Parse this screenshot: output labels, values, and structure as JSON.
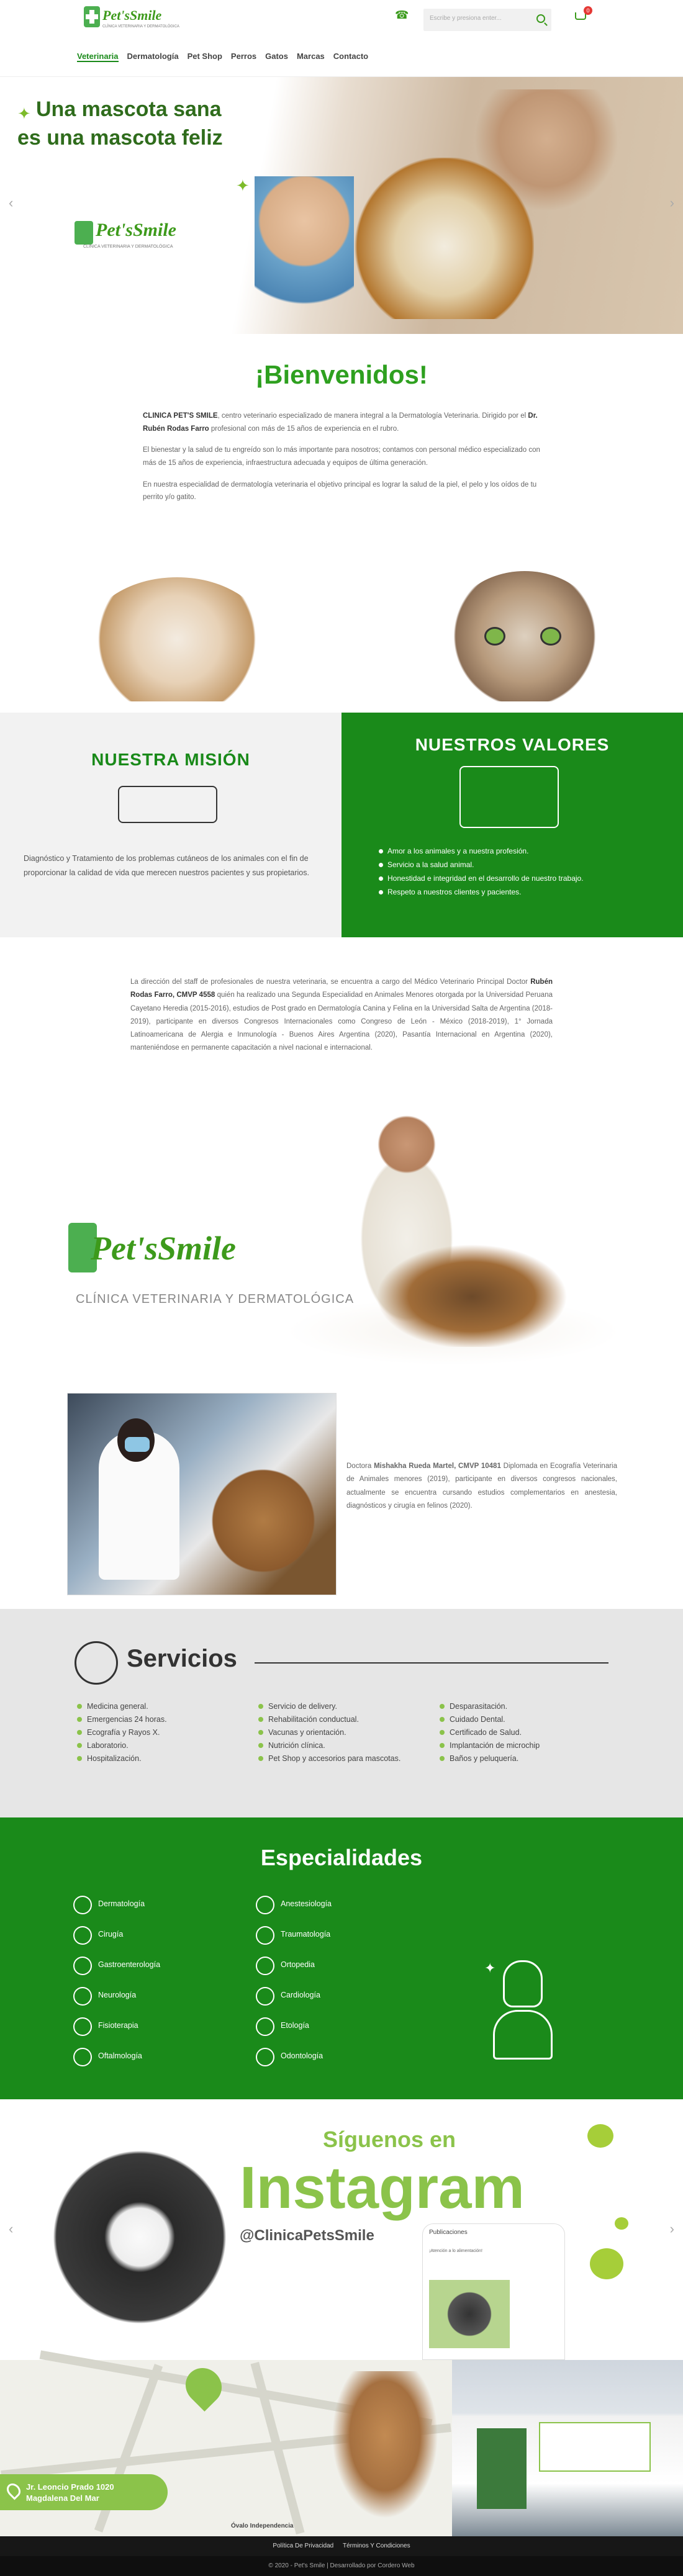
{
  "header": {
    "logo": {
      "name": "Pet'sSmile",
      "subtitle": "CLÍNICA VETERINARIA Y DERMATOLÓGICA"
    },
    "search_placeholder": "Escribe y presiona enter...",
    "cart_count": "0",
    "nav": [
      "Veterinaria",
      "Dermatología",
      "Pet Shop",
      "Perros",
      "Gatos",
      "Marcas",
      "Contacto"
    ]
  },
  "hero": {
    "line1": "Una mascota sana",
    "line2": "es una mascota feliz",
    "logo_name": "Pet'sSmile",
    "logo_sub": "CLÍNICA VETERINARIA Y DERMATOLÓGICA"
  },
  "welcome": {
    "title": "¡Bienvenidos!",
    "p1_brand": "CLINICA PET'S SMILE",
    "p1_rest": ", centro veterinario especializado de manera integral a la Dermatología Veterinaria. Dirigido por el ",
    "p1_doctor": "Dr. Rubén Rodas Farro",
    "p1_end": " profesional con más de 15 años de experiencia en el rubro.",
    "p2": "El bienestar y la salud de tu engreído son lo más importante para nosotros; contamos con personal médico especializado con más de 15 años de experiencia, infraestructura adecuada y equipos de última generación.",
    "p3": "En nuestra especialidad de dermatología veterinaria el objetivo principal es lograr la salud de la piel, el pelo y los oídos de tu perrito y/o gatito."
  },
  "mision": {
    "title": "NUESTRA MISIÓN",
    "text": "Diagnóstico y Tratamiento de los problemas cutáneos de los animales con el fin de proporcionar la calidad de vida que merecen nuestros pacientes y sus propietarios."
  },
  "valores": {
    "title": "NUESTROS VALORES",
    "items": [
      "Amor a los animales y a nuestra profesión.",
      "Servicio a la salud animal.",
      "Honestidad e integridad en el desarrollo de nuestro trabajo.",
      "Respeto a nuestros clientes y pacientes."
    ]
  },
  "director": {
    "pre": "La dirección del staff de profesionales de nuestra veterinaria, se encuentra a cargo del Médico Veterinario Principal Doctor ",
    "name": "Rubén Rodas Farro, CMVP 4558",
    "post": " quién ha realizado una Segunda Especialidad en Animales Menores otorgada por la Universidad Peruana Cayetano Heredia (2015-2016), estudios de Post grado en Dermatología Canina y Felina en la Universidad Salta de Argentina (2018-2019), participante en diversos Congresos Internacionales como Congreso de León - México (2018-2019), 1° Jornada Latinoamericana de Alergia e Inmunología - Buenos Aires Argentina (2020), Pasantía Internacional en Argentina (2020), manteniéndose en permanente capacitación a nivel nacional e internacional."
  },
  "brand": {
    "name": "Pet'sSmile",
    "sub": "CLÍNICA VETERINARIA Y DERMATOLÓGICA"
  },
  "doctora": {
    "pre": "Doctora ",
    "name": "Mishakha Rueda Martel, CMVP 10481",
    "post": " Diplomada en Ecografía Veterinaria de Animales menores (2019), participante en diversos congresos nacionales, actualmente se encuentra cursando estudios complementarios en anestesia, diagnósticos y cirugía en felinos (2020)."
  },
  "servicios": {
    "title": "Servicios",
    "col1": [
      "Medicina general.",
      "Emergencias 24 horas.",
      "Ecografía y Rayos X.",
      "Laboratorio.",
      "Hospitalización."
    ],
    "col2": [
      "Servicio de delivery.",
      "Rehabilitación conductual.",
      "Vacunas y orientación.",
      "Nutrición clínica.",
      "Pet Shop y accesorios para mascotas."
    ],
    "col3": [
      "Desparasitación.",
      "Cuidado Dental.",
      "Certificado de Salud.",
      "Implantación de microchip",
      "Baños y peluquería."
    ]
  },
  "especialidades": {
    "title": "Especialidades",
    "col1": [
      "Dermatología",
      "Cirugía",
      "Gastroenterología",
      "Neurología",
      "Fisioterapia",
      "Oftalmología"
    ],
    "col2": [
      "Anestesiología",
      "Traumatología",
      "Ortopedia",
      "Cardiología",
      "Etología",
      "Odontología"
    ]
  },
  "instagram": {
    "line1": "Síguenos en",
    "line2": "Instagram",
    "handle": "@ClinicaPetsSmile",
    "phone_header": "Publicaciones",
    "phone_caption": "¡Atención a lo alimentación!"
  },
  "map": {
    "address_line1": "Jr. Leoncio Prado 1020",
    "address_line2": "Magdalena Del Mar",
    "landmark": "Óvalo Independencia"
  },
  "footer": {
    "links": [
      "Política De Privacidad",
      "Términos Y Condiciones"
    ],
    "copyright": "© 2020 - Pet's Smile | Desarrollado por Cordero Web"
  }
}
